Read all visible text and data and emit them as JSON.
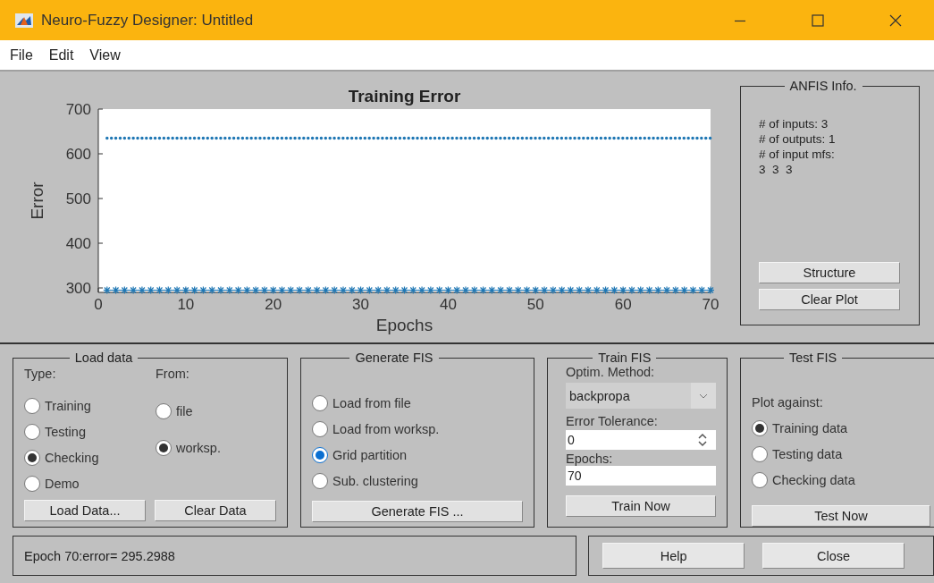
{
  "window": {
    "title": "Neuro-Fuzzy Designer: Untitled"
  },
  "menu": [
    "File",
    "Edit",
    "View"
  ],
  "plot": {
    "chart_data": {
      "type": "line",
      "title": "Training Error",
      "xlabel": "Epochs",
      "ylabel": "Error",
      "xlim": [
        0,
        70
      ],
      "ylim": [
        290,
        700
      ],
      "xticks": [
        0,
        10,
        20,
        30,
        40,
        50,
        60,
        70
      ],
      "yticks": [
        300,
        400,
        500,
        600,
        700
      ],
      "x": [
        1,
        2,
        3,
        4,
        5,
        6,
        7,
        8,
        9,
        10,
        11,
        12,
        13,
        14,
        15,
        16,
        17,
        18,
        19,
        20,
        21,
        22,
        23,
        24,
        25,
        26,
        27,
        28,
        29,
        30,
        31,
        32,
        33,
        34,
        35,
        36,
        37,
        38,
        39,
        40,
        41,
        42,
        43,
        44,
        45,
        46,
        47,
        48,
        49,
        50,
        51,
        52,
        53,
        54,
        55,
        56,
        57,
        58,
        59,
        60,
        61,
        62,
        63,
        64,
        65,
        66,
        67,
        68,
        69,
        70
      ],
      "series": [
        {
          "color": "#1f77b4",
          "line_style": "dotted",
          "marker": "none",
          "values": [
            635,
            635,
            635,
            635,
            635,
            635,
            635,
            635,
            635,
            635,
            635,
            635,
            635,
            635,
            635,
            635,
            635,
            635,
            635,
            635,
            635,
            635,
            635,
            635,
            635,
            635,
            635,
            635,
            635,
            635,
            635,
            635,
            635,
            635,
            635,
            635,
            635,
            635,
            635,
            635,
            635,
            635,
            635,
            635,
            635,
            635,
            635,
            635,
            635,
            635,
            635,
            635,
            635,
            635,
            635,
            635,
            635,
            635,
            635,
            635,
            635,
            635,
            635,
            635,
            635,
            635,
            635,
            635,
            635,
            635
          ]
        },
        {
          "color": "#1f77b4",
          "line_style": "solid",
          "marker": "cross",
          "values": [
            295,
            295,
            295,
            295,
            295,
            295,
            295,
            295,
            295,
            295,
            295,
            295,
            295,
            295,
            295,
            295,
            295,
            295,
            295,
            295,
            295,
            295,
            295,
            295,
            295,
            295,
            295,
            295,
            295,
            295,
            295,
            295,
            295,
            295,
            295,
            295,
            295,
            295,
            295,
            295,
            295,
            295,
            295,
            295,
            295,
            295,
            295,
            295,
            295,
            295,
            295,
            295,
            295,
            295,
            295,
            295,
            295,
            295,
            295,
            295,
            295,
            295,
            295,
            295,
            295,
            295,
            295,
            295,
            295,
            295
          ]
        }
      ]
    }
  },
  "anfis_info": {
    "title": "ANFIS Info.",
    "lines": [
      "# of inputs: 3",
      "# of outputs: 1",
      "# of input mfs:",
      "3  3  3"
    ],
    "buttons": [
      "Structure",
      "Clear Plot"
    ]
  },
  "load_data": {
    "title": "Load data",
    "type_label": "Type:",
    "from_label": "From:",
    "types": [
      {
        "label": "Training",
        "selected": false
      },
      {
        "label": "Testing",
        "selected": false
      },
      {
        "label": "Checking",
        "selected": true
      },
      {
        "label": "Demo",
        "selected": false
      }
    ],
    "sources": [
      {
        "label": "file",
        "selected": false
      },
      {
        "label": "worksp.",
        "selected": true
      }
    ],
    "buttons": [
      "Load Data...",
      "Clear Data"
    ]
  },
  "generate_fis": {
    "title": "Generate FIS",
    "options": [
      {
        "label": "Load from file",
        "selected": false
      },
      {
        "label": "Load from worksp.",
        "selected": false
      },
      {
        "label": "Grid partition",
        "selected": true
      },
      {
        "label": "Sub. clustering",
        "selected": false
      }
    ],
    "button": "Generate FIS ..."
  },
  "train_fis": {
    "title": "Train FIS",
    "method_label": "Optim. Method:",
    "method": "backpropa",
    "tolerance_label": "Error Tolerance:",
    "tolerance": "0",
    "epochs_label": "Epochs:",
    "epochs": "70",
    "button": "Train Now"
  },
  "test_fis": {
    "title": "Test FIS",
    "plot_label": "Plot against:",
    "options": [
      {
        "label": "Training data",
        "selected": true
      },
      {
        "label": "Testing data",
        "selected": false
      },
      {
        "label": "Checking data",
        "selected": false
      }
    ],
    "button": "Test Now"
  },
  "status": "Epoch 70:error= 295.2988",
  "buttons": [
    "Help",
    "Close"
  ]
}
